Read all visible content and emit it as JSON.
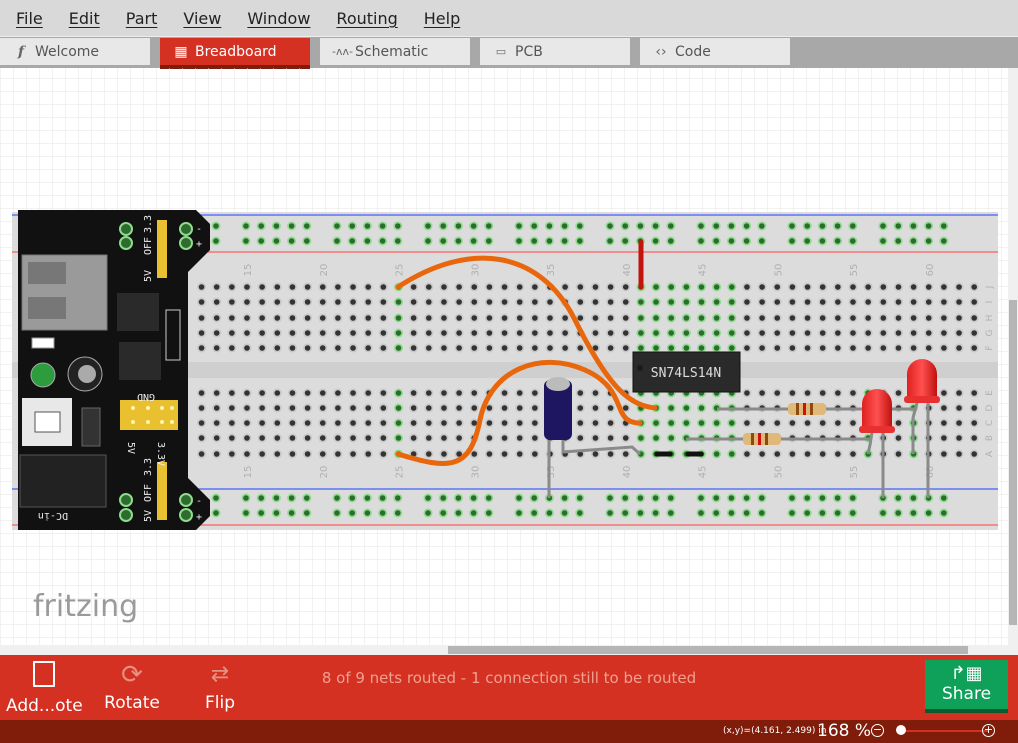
{
  "menu": [
    "File",
    "Edit",
    "Part",
    "View",
    "Window",
    "Routing",
    "Help"
  ],
  "tabs": [
    {
      "label": "Welcome",
      "icon": "fritzing-f-icon",
      "active": false
    },
    {
      "label": "Breadboard",
      "icon": "breadboard-icon",
      "active": true
    },
    {
      "label": "Schematic",
      "icon": "schematic-icon",
      "active": false
    },
    {
      "label": "PCB",
      "icon": "pcb-icon",
      "active": false
    },
    {
      "label": "Code",
      "icon": "code-icon",
      "active": false
    }
  ],
  "breadboard": {
    "column_labels": [
      "15",
      "20",
      "25",
      "30",
      "35",
      "40",
      "45",
      "50",
      "55",
      "60"
    ],
    "row_labels_top": [
      "J",
      "I",
      "H",
      "G",
      "F"
    ],
    "row_labels_bottom": [
      "E",
      "D",
      "C",
      "B",
      "A"
    ],
    "ic_label": "SN74LS14N",
    "power_module": {
      "top_jumper": [
        "5V",
        "OFF",
        "3.3"
      ],
      "bottom_jumper": [
        "5V",
        "OFF",
        "3.3"
      ],
      "gnd": "GND",
      "v5": "5V",
      "v33": "3.3V",
      "dc": "DC-in",
      "minus": "-",
      "plus": "+"
    }
  },
  "logo": "fritzing",
  "toolbar": {
    "add_note": "Add...ote",
    "rotate": "Rotate",
    "flip": "Flip",
    "share": "Share",
    "status": "8 of 9 nets routed - 1 connection still to be routed"
  },
  "statusbar": {
    "coords": "(x,y)=(4.161, 2.499) in",
    "zoom": "168 %",
    "zoom_level": 168
  },
  "colors": {
    "accent": "#d43122",
    "dark_accent": "#7f1d0a",
    "share": "#0fa05a",
    "wire_orange": "#e8670c",
    "wire_red": "#c0140c"
  }
}
